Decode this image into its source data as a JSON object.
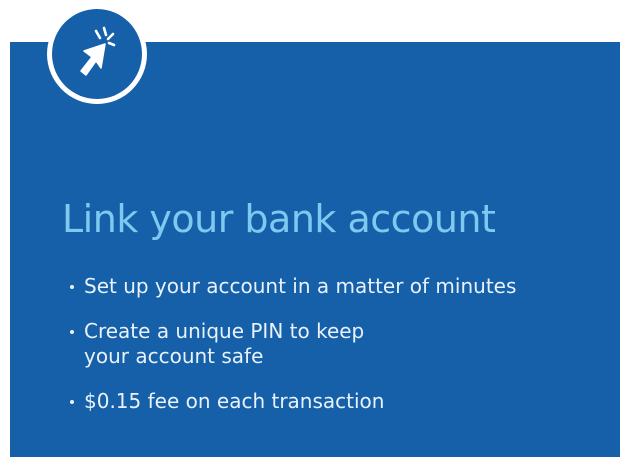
{
  "icon": "cursor-click-icon",
  "colors": {
    "card_bg": "#1560a8",
    "title": "#7fc8f0",
    "text": "#e9f2fb",
    "badge_ring": "#ffffff"
  },
  "title": "Link your bank account",
  "benefits": [
    {
      "lines": [
        "Set up your account in a matter of minutes"
      ]
    },
    {
      "lines": [
        "Create a unique PIN to keep",
        "your account safe"
      ]
    },
    {
      "lines": [
        "$0.15 fee on each transaction"
      ]
    }
  ]
}
